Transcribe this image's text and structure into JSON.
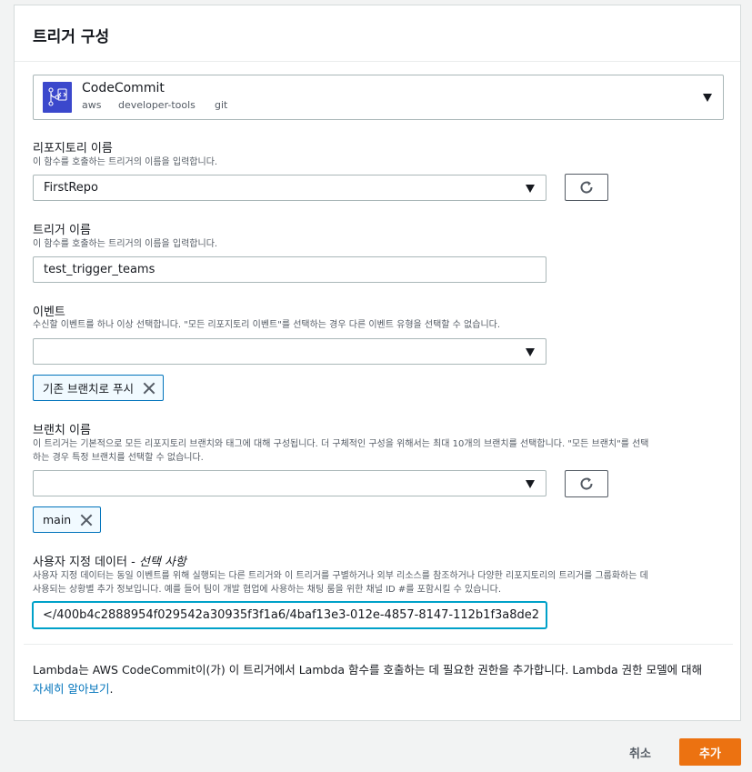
{
  "panel": {
    "title": "트리거 구성"
  },
  "trigger": {
    "name": "CodeCommit",
    "tags": [
      "aws",
      "developer-tools",
      "git"
    ],
    "logo": "codecommit-icon"
  },
  "repository": {
    "label": "리포지토리 이름",
    "description": "이 함수를 호출하는 트리거의 이름을 입력합니다.",
    "value": "FirstRepo"
  },
  "trigger_name": {
    "label": "트리거 이름",
    "description": "이 함수를 호출하는 트리거의 이름을 입력합니다.",
    "value": "test_trigger_teams"
  },
  "events": {
    "label": "이벤트",
    "description": "수신할 이벤트를 하나 이상 선택합니다. \"모든 리포지토리 이벤트\"를 선택하는 경우 다른 이벤트 유형을 선택할 수 없습니다.",
    "value": "",
    "tokens": [
      "기존 브랜치로 푸시"
    ]
  },
  "branch": {
    "label": "브랜치 이름",
    "description_line1": "이 트리거는 기본적으로 모든 리포지토리 브랜치와 태그에 대해 구성됩니다. 더 구체적인 구성을 위해서는 최대 10개의 브랜치를 선택합니다. \"모든 브랜치\"를 선택",
    "description_line2": "하는 경우 특정 브랜치를 선택할 수 없습니다.",
    "value": "",
    "tokens": [
      "main"
    ]
  },
  "custom_data": {
    "label": "사용자 지정 데이터 - ",
    "label_optional": "선택 사항",
    "description_line1": "사용자 지정 데이터는 동일 이벤트를 위해 실행되는 다른 트리거와 이 트리거를 구별하거나 외부 리소스를 참조하거나 다양한 리포지토리의 트리거를 그룹화하는 데",
    "description_line2": "사용되는 상황별 추가 정보입니다. 예를 들어 팀이 개발 협업에 사용하는 채팅 룸을 위한 채널 ID #를 포함시킬 수 있습니다.",
    "value": "</400b4c2888954f029542a30935f3f1a6/4baf13e3-012e-4857-8147-112b1f3a8de2"
  },
  "permissions": {
    "text": "Lambda는 AWS CodeCommit이(가) 이 트리거에서 Lambda 함수를 호출하는 데 필요한 권한을 추가합니다. Lambda 권한 모델에 대해",
    "link": "자세히 알아보기",
    "suffix": "."
  },
  "actions": {
    "cancel": "취소",
    "add": "추가"
  },
  "colors": {
    "primary": "#ec7211",
    "link": "#0073bb",
    "focus": "#00a1c9",
    "token_border": "#0073bb"
  }
}
